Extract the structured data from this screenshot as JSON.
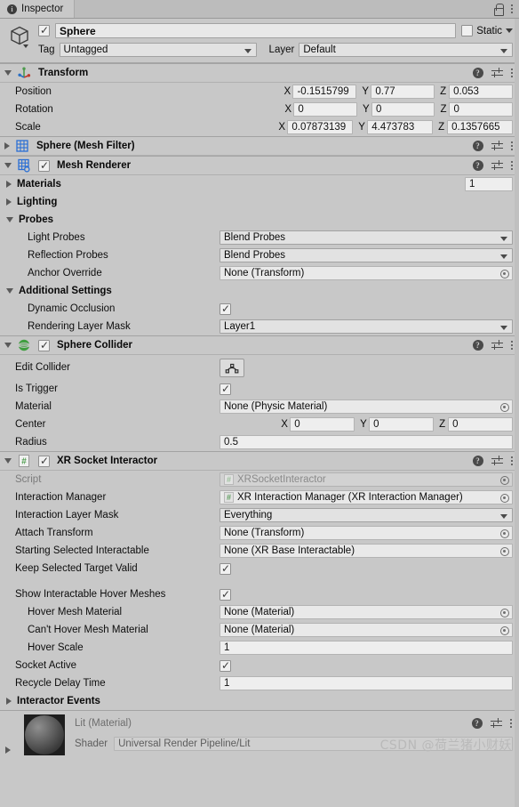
{
  "window": {
    "tab_label": "Inspector",
    "tab_icon": "info-icon",
    "lock_icon": "lock-icon",
    "menu_icon": "kebab-menu-icon"
  },
  "gameobject": {
    "icon": "cube-icon",
    "enabled": true,
    "name": "Sphere",
    "static_label": "Static",
    "static_checked": false,
    "tag_label": "Tag",
    "tag_value": "Untagged",
    "layer_label": "Layer",
    "layer_value": "Default"
  },
  "components": [
    {
      "name": "Transform",
      "icon": "transform-gizmo-icon",
      "expanded": true,
      "has_enable_toggle": false,
      "rows": [
        {
          "type": "vector3",
          "label": "Position",
          "x": "-0.1515799",
          "y": "0.77",
          "z": "0.053"
        },
        {
          "type": "vector3",
          "label": "Rotation",
          "x": "0",
          "y": "0",
          "z": "0"
        },
        {
          "type": "vector3",
          "label": "Scale",
          "x": "0.07873139",
          "y": "4.473783",
          "z": "0.1357665"
        }
      ]
    },
    {
      "name": "Sphere (Mesh Filter)",
      "icon": "mesh-filter-icon",
      "expanded": false,
      "has_enable_toggle": false,
      "rows": []
    },
    {
      "name": "Mesh Renderer",
      "icon": "mesh-renderer-icon",
      "expanded": true,
      "has_enable_toggle": true,
      "enabled": true,
      "rows": [
        {
          "type": "foldout_value",
          "label": "Materials",
          "expanded": false,
          "value": "1"
        },
        {
          "type": "foldout",
          "label": "Lighting",
          "expanded": false
        },
        {
          "type": "foldout",
          "label": "Probes",
          "expanded": true
        },
        {
          "type": "dropdown",
          "label": "Light Probes",
          "indent": 1,
          "value": "Blend Probes"
        },
        {
          "type": "dropdown",
          "label": "Reflection Probes",
          "indent": 1,
          "value": "Blend Probes"
        },
        {
          "type": "object",
          "label": "Anchor Override",
          "indent": 1,
          "value": "None (Transform)"
        },
        {
          "type": "foldout",
          "label": "Additional Settings",
          "expanded": true,
          "bold": true
        },
        {
          "type": "checkbox",
          "label": "Dynamic Occlusion",
          "indent": 1,
          "checked": true
        },
        {
          "type": "dropdown",
          "label": "Rendering Layer Mask",
          "indent": 1,
          "value": "Layer1"
        }
      ]
    },
    {
      "name": "Sphere Collider",
      "icon": "sphere-collider-icon",
      "expanded": true,
      "has_enable_toggle": true,
      "enabled": true,
      "rows": [
        {
          "type": "button",
          "label": "Edit Collider",
          "button_icon": "edit-collider-icon"
        },
        {
          "type": "checkbox",
          "label": "Is Trigger",
          "checked": true
        },
        {
          "type": "object",
          "label": "Material",
          "value": "None (Physic Material)"
        },
        {
          "type": "vector3",
          "label": "Center",
          "x": "0",
          "y": "0",
          "z": "0"
        },
        {
          "type": "text",
          "label": "Radius",
          "value": "0.5"
        }
      ]
    },
    {
      "name": "XR Socket Interactor",
      "icon": "csharp-script-icon",
      "expanded": true,
      "has_enable_toggle": true,
      "enabled": true,
      "rows": [
        {
          "type": "script",
          "label": "Script",
          "value": "XRSocketInteractor",
          "disabled": true
        },
        {
          "type": "script",
          "label": "Interaction Manager",
          "value": "XR Interaction Manager (XR Interaction Manager)"
        },
        {
          "type": "dropdown",
          "label": "Interaction Layer Mask",
          "value": "Everything"
        },
        {
          "type": "object",
          "label": "Attach Transform",
          "value": "None (Transform)"
        },
        {
          "type": "object",
          "label": "Starting Selected Interactable",
          "value": "None (XR Base Interactable)"
        },
        {
          "type": "checkbox",
          "label": "Keep Selected Target Valid",
          "checked": true
        },
        {
          "type": "spacer"
        },
        {
          "type": "checkbox",
          "label": "Show Interactable Hover Meshes",
          "checked": true
        },
        {
          "type": "object",
          "label": "Hover Mesh Material",
          "indent": 1,
          "value": "None (Material)"
        },
        {
          "type": "object",
          "label": "Can't Hover Mesh Material",
          "indent": 1,
          "value": "None (Material)"
        },
        {
          "type": "text",
          "label": "Hover Scale",
          "indent": 1,
          "value": "1"
        },
        {
          "type": "checkbox",
          "label": "Socket Active",
          "checked": true
        },
        {
          "type": "text",
          "label": "Recycle Delay Time",
          "value": "1"
        },
        {
          "type": "foldout",
          "label": "Interactor Events",
          "expanded": false
        }
      ]
    }
  ],
  "material_footer": {
    "title": "Lit (Material)",
    "shader_label": "Shader",
    "shader_value": "Universal Render Pipeline/Lit",
    "preview_icon": "material-sphere-preview",
    "expand_icon": "foldout-closed-icon"
  },
  "watermark": "CSDN @荷兰猪小财妖",
  "colors": {
    "panel_bg": "#c8c8c8",
    "field_bg": "#eeeeee",
    "header_bg": "#c8c8c8",
    "script_green": "#5f9e5f",
    "collider_green": "#3f9e3f",
    "mesh_blue": "#2b6fd4"
  }
}
